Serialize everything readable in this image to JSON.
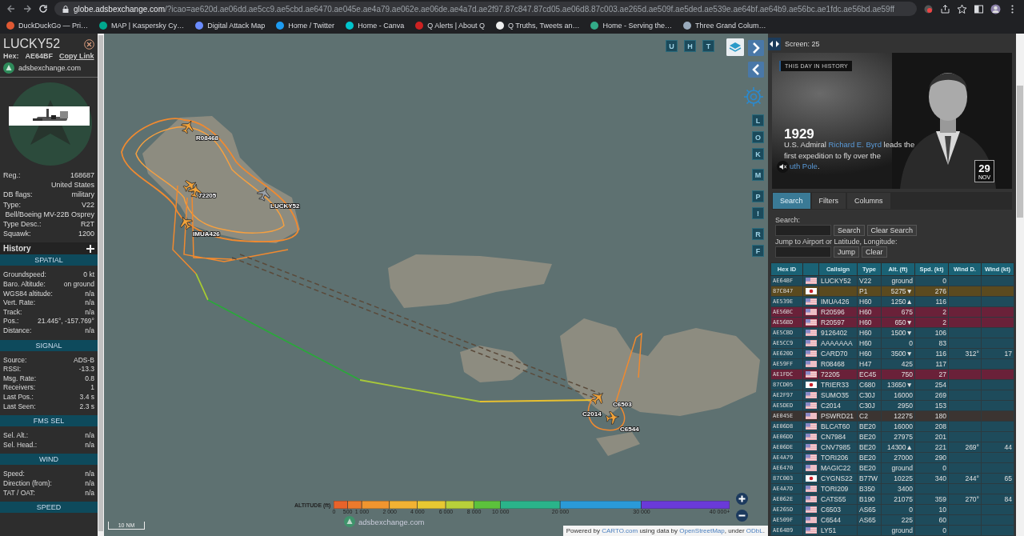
{
  "browser": {
    "url_host": "globe.adsbexchange.com",
    "url_path": "/?icao=ae620d.ae06dd.ae5cc9.ae5cbd.ae6470.ae045e.ae4a79.ae062e.ae06de.ae4a7d.ae2f97.87c847.87cd05.ae06d8.87c003.ae265d.ae509f.ae5ded.ae539e.ae64bf.ae64b9.ae56bc.ae1fdc.ae56bd.ae59ff",
    "bookmarks": [
      {
        "label": "DuckDuckGo — Pri…",
        "color": "#de5833"
      },
      {
        "label": "MAP | Kaspersky Cy…",
        "color": "#00a88e"
      },
      {
        "label": "Digital Attack Map",
        "color": "#6a8cff"
      },
      {
        "label": "Home / Twitter",
        "color": "#1d9bf0"
      },
      {
        "label": "Home - Canva",
        "color": "#00c4cc"
      },
      {
        "label": "Q Alerts | About Q",
        "color": "#cc2222"
      },
      {
        "label": "Q Truths, Tweets an…",
        "color": "#eeeeee"
      },
      {
        "label": "Home - Serving the…",
        "color": "#33aa88"
      },
      {
        "label": "Three Grand Colum…",
        "color": "#99aabb"
      }
    ]
  },
  "aircraft": {
    "callsign": "LUCKY52",
    "hex_label": "Hex:",
    "hex": "AE64BF",
    "copy_link": "Copy Link",
    "site": "adsbexchange.com",
    "details": [
      {
        "label": "Reg.:",
        "value": "168687"
      },
      {
        "value": "United States"
      },
      {
        "label": "DB flags:",
        "value": "military"
      },
      {
        "label": "Type:",
        "value": "V22"
      },
      {
        "value": "Bell/Boeing MV-22B Osprey"
      },
      {
        "label": "Type Desc.:",
        "value": "R2T"
      },
      {
        "label": "Squawk:",
        "value": "1200"
      }
    ]
  },
  "history": {
    "title": "History",
    "sections": [
      {
        "title": "SPATIAL",
        "rows": [
          {
            "label": "Groundspeed:",
            "value": "0 kt"
          },
          {
            "label": "Baro. Altitude:",
            "value": "on ground"
          },
          {
            "label": "WGS84 altitude:",
            "value": "n/a"
          },
          {
            "label": "Vert. Rate:",
            "value": "n/a"
          },
          {
            "label": "Track:",
            "value": "n/a"
          },
          {
            "label": "Pos.:",
            "value": "21.445°, -157.769°"
          },
          {
            "label": "Distance:",
            "value": "n/a"
          }
        ]
      },
      {
        "title": "SIGNAL",
        "rows": [
          {
            "label": "Source:",
            "value": "ADS-B"
          },
          {
            "label": "RSSI:",
            "value": "-13.3"
          },
          {
            "label": "Msg. Rate:",
            "value": "0.8"
          },
          {
            "label": "Receivers:",
            "value": "1"
          },
          {
            "label": "Last Pos.:",
            "value": "3.4 s"
          },
          {
            "label": "Last Seen:",
            "value": "2.3 s"
          }
        ]
      },
      {
        "title": "FMS SEL",
        "rows": [
          {
            "label": "Sel. Alt.:",
            "value": "n/a"
          },
          {
            "label": "Sel. Head.:",
            "value": "n/a"
          }
        ]
      },
      {
        "title": "WIND",
        "rows": [
          {
            "label": "Speed:",
            "value": "n/a"
          },
          {
            "label": "Direction (from):",
            "value": "n/a"
          },
          {
            "label": "TAT / OAT:",
            "value": "n/a"
          }
        ]
      },
      {
        "title": "SPEED"
      }
    ]
  },
  "map": {
    "aircraft_labels": [
      "R08468",
      "72205",
      "LUCKY52",
      "IMUA426",
      "C6503",
      "C2014",
      "C6544"
    ],
    "top_buttons": [
      "U",
      "H",
      "T"
    ],
    "side_buttons": [
      "L",
      "O",
      "K",
      "M",
      "P",
      "!",
      "R",
      "F"
    ],
    "legend": {
      "title": "ALTITUDE (ft)",
      "ticks": [
        "0",
        "500",
        "1 000",
        "2 000",
        "4 000",
        "6 000",
        "8 000",
        "10 000",
        "20 000",
        "30 000",
        "40 000+"
      ]
    },
    "scale": "10 NM",
    "logo": "adsbexchange.com",
    "attribution": [
      {
        "text": "Powered by "
      },
      {
        "text": "CARTO.com",
        "link": true
      },
      {
        "text": " using data by "
      },
      {
        "text": "OpenStreetMap",
        "link": true
      },
      {
        "text": ", under "
      },
      {
        "text": "ODbL",
        "link": true
      },
      {
        "text": "."
      }
    ]
  },
  "screen_count": "Screen: 25",
  "day_in_history": {
    "label": "THIS DAY IN HISTORY",
    "year": "1929",
    "muted": true,
    "parts": [
      {
        "text": "U.S. Admiral "
      },
      {
        "text": "Richard E. Byrd",
        "link": true
      },
      {
        "text": " leads the first expedition to fly over the "
      },
      {
        "text": "uth Pole",
        "link": true,
        "icon_before": true
      },
      {
        "text": "."
      }
    ],
    "day": "29",
    "month": "NOV"
  },
  "tabs": [
    {
      "label": "Search",
      "selected": true
    },
    {
      "label": "Filters",
      "selected": false
    },
    {
      "label": "Columns",
      "selected": false
    }
  ],
  "search": {
    "search_label": "Search:",
    "search_button": "Search",
    "clear_search_button": "Clear Search",
    "jump_label": "Jump to Airport or Latitude, Longitude:",
    "jump_button": "Jump",
    "clear_button": "Clear"
  },
  "table": {
    "columns": [
      "Hex ID",
      "",
      "Callsign",
      "Type",
      "Alt. (ft)",
      "Spd. (kt)",
      "Wind D.",
      "Wind (kt)"
    ],
    "rows": [
      {
        "hex": "AE64BF",
        "kind": "us",
        "callsign": "LUCKY52",
        "type": "V22",
        "alt": "ground",
        "spd": "0",
        "color": "#1e4b5b"
      },
      {
        "hex": "87C847",
        "kind": "jp",
        "type": "P1",
        "alt": "5275▼",
        "spd": "276",
        "color": "#5b4a1f"
      },
      {
        "hex": "AE539E",
        "kind": "us",
        "callsign": "IMUA426",
        "type": "H60",
        "alt": "1250▲",
        "spd": "116",
        "color": "#1e4b5b"
      },
      {
        "hex": "AE56BC",
        "kind": "us",
        "callsign": "R20596",
        "type": "H60",
        "alt": "675",
        "spd": "2",
        "color": "#6a2139"
      },
      {
        "hex": "AE56BD",
        "kind": "us",
        "callsign": "R20597",
        "type": "H60",
        "alt": "650▼",
        "spd": "2",
        "color": "#6a2139"
      },
      {
        "hex": "AE5CBD",
        "kind": "us",
        "callsign": "9126402",
        "type": "H60",
        "alt": "1500▼",
        "spd": "106",
        "color": "#1e4b5b"
      },
      {
        "hex": "AE5CC9",
        "kind": "us",
        "callsign": "AAAAAAA",
        "type": "H60",
        "alt": "0",
        "spd": "83",
        "color": "#1e4b5b"
      },
      {
        "hex": "AE620D",
        "kind": "us",
        "callsign": "CARD70",
        "type": "H60",
        "alt": "3500▼",
        "spd": "116",
        "wind_dir": "312°",
        "wind_kt": "17",
        "color": "#1e4b5b"
      },
      {
        "hex": "AE59FF",
        "kind": "us",
        "callsign": "R08468",
        "type": "H47",
        "alt": "425",
        "spd": "117",
        "color": "#1e4b5b"
      },
      {
        "hex": "AE1FDC",
        "kind": "us",
        "callsign": "72205",
        "type": "EC45",
        "alt": "750",
        "spd": "27",
        "color": "#6a2139"
      },
      {
        "hex": "87CD05",
        "kind": "jp",
        "callsign": "TRIER33",
        "type": "C680",
        "alt": "13650▼",
        "spd": "254",
        "color": "#1e4b5b"
      },
      {
        "hex": "AE2F97",
        "kind": "us",
        "callsign": "SUMO35",
        "type": "C30J",
        "alt": "16000",
        "spd": "269",
        "color": "#1e4b5b"
      },
      {
        "hex": "AE5DED",
        "kind": "us",
        "callsign": "C2014",
        "type": "C30J",
        "alt": "2950",
        "spd": "153",
        "color": "#1e4b5b"
      },
      {
        "hex": "AE045E",
        "kind": "us",
        "callsign": "PSWRD21",
        "type": "C2",
        "alt": "12275",
        "spd": "180",
        "color": "#3b3431"
      },
      {
        "hex": "AE06D8",
        "kind": "us",
        "callsign": "BLCAT60",
        "type": "BE20",
        "alt": "16000",
        "spd": "208",
        "color": "#1e4b5b"
      },
      {
        "hex": "AE06DD",
        "kind": "us",
        "callsign": "CN7984",
        "type": "BE20",
        "alt": "27975",
        "spd": "201",
        "color": "#1e4b5b"
      },
      {
        "hex": "AE06DE",
        "kind": "us",
        "callsign": "CNV7985",
        "type": "BE20",
        "alt": "14300▲",
        "spd": "221",
        "wind_dir": "269°",
        "wind_kt": "44",
        "color": "#1e4b5b"
      },
      {
        "hex": "AE4A79",
        "kind": "us",
        "callsign": "TORI206",
        "type": "BE20",
        "alt": "27000",
        "spd": "290",
        "color": "#1e4b5b"
      },
      {
        "hex": "AE6470",
        "kind": "us",
        "callsign": "MAGIC22",
        "type": "BE20",
        "alt": "ground",
        "spd": "0",
        "color": "#1e4b5b"
      },
      {
        "hex": "87C003",
        "kind": "jp",
        "callsign": "CYGNS22",
        "type": "B77W",
        "alt": "10225",
        "spd": "340",
        "wind_dir": "244°",
        "wind_kt": "65",
        "color": "#1e4b5b"
      },
      {
        "hex": "AE4A7D",
        "kind": "us",
        "callsign": "TORI209",
        "type": "B350",
        "alt": "3400",
        "color": "#1e4b5b"
      },
      {
        "hex": "AE062E",
        "kind": "us",
        "callsign": "CATS55",
        "type": "B190",
        "alt": "21075",
        "spd": "359",
        "wind_dir": "270°",
        "wind_kt": "84",
        "color": "#1e4b5b"
      },
      {
        "hex": "AE265D",
        "kind": "us",
        "callsign": "C6503",
        "type": "AS65",
        "alt": "0",
        "spd": "10",
        "color": "#1e4b5b"
      },
      {
        "hex": "AE509F",
        "kind": "us",
        "callsign": "C6544",
        "type": "AS65",
        "alt": "225",
        "spd": "60",
        "color": "#1e4b5b"
      },
      {
        "hex": "AE64B9",
        "kind": "us",
        "callsign": "LY51",
        "alt": "ground",
        "spd": "0",
        "color": "#1e4b5b"
      }
    ]
  }
}
